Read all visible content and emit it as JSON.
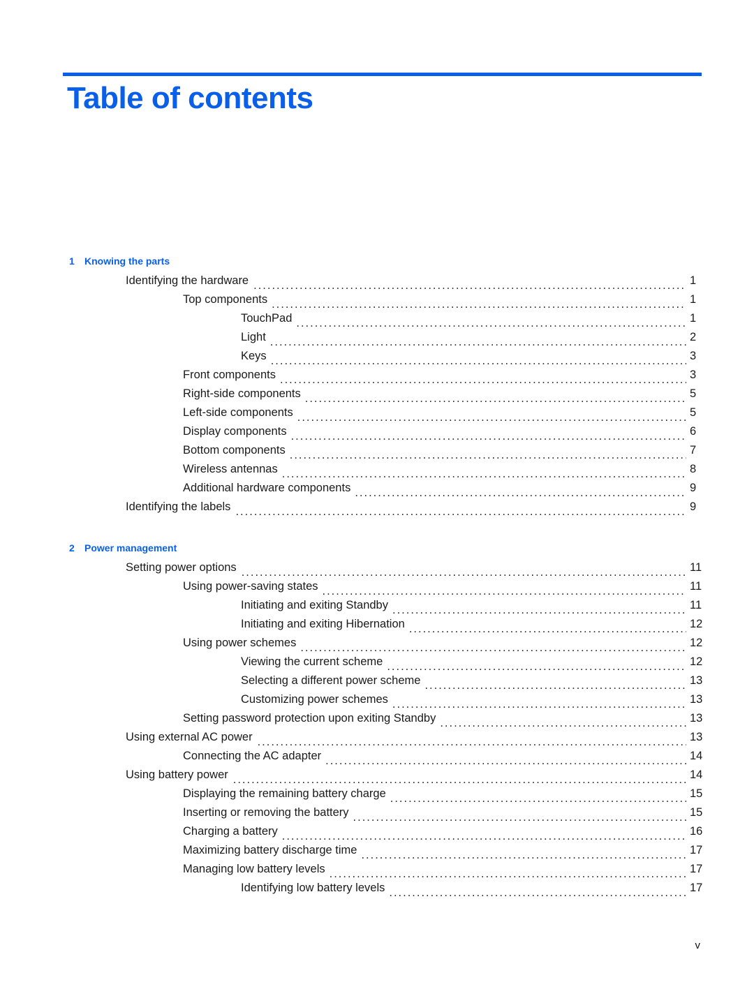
{
  "document": {
    "title": "Table of contents",
    "folio": "v"
  },
  "colors": {
    "accent_blue": "#0a5fe8",
    "body_text": "#1a1a1a"
  },
  "toc": {
    "chapters": [
      {
        "number": "1",
        "title": "Knowing the parts",
        "entries": [
          {
            "text": "Identifying the hardware",
            "page": "1",
            "level": 1
          },
          {
            "text": "Top components",
            "page": "1",
            "level": 2
          },
          {
            "text": "TouchPad",
            "page": "1",
            "level": 3
          },
          {
            "text": "Light",
            "page": "2",
            "level": 3
          },
          {
            "text": "Keys",
            "page": "3",
            "level": 3
          },
          {
            "text": "Front components",
            "page": "3",
            "level": 2
          },
          {
            "text": "Right-side components",
            "page": "5",
            "level": 2
          },
          {
            "text": "Left-side components",
            "page": "5",
            "level": 2
          },
          {
            "text": "Display components",
            "page": "6",
            "level": 2
          },
          {
            "text": "Bottom components",
            "page": "7",
            "level": 2
          },
          {
            "text": "Wireless antennas",
            "page": "8",
            "level": 2
          },
          {
            "text": "Additional hardware components",
            "page": "9",
            "level": 2
          },
          {
            "text": "Identifying the labels",
            "page": "9",
            "level": 1
          }
        ]
      },
      {
        "number": "2",
        "title": "Power management",
        "entries": [
          {
            "text": "Setting power options",
            "page": "11",
            "level": 1
          },
          {
            "text": "Using power-saving states",
            "page": "11",
            "level": 2
          },
          {
            "text": "Initiating and exiting Standby",
            "page": "11",
            "level": 3
          },
          {
            "text": "Initiating and exiting Hibernation",
            "page": "12",
            "level": 3
          },
          {
            "text": "Using power schemes",
            "page": "12",
            "level": 2
          },
          {
            "text": "Viewing the current scheme",
            "page": "12",
            "level": 3
          },
          {
            "text": "Selecting a different power scheme",
            "page": "13",
            "level": 3
          },
          {
            "text": "Customizing power schemes",
            "page": "13",
            "level": 3
          },
          {
            "text": "Setting password protection upon exiting Standby",
            "page": "13",
            "level": 2
          },
          {
            "text": "Using external AC power",
            "page": "13",
            "level": 1
          },
          {
            "text": "Connecting the AC adapter",
            "page": "14",
            "level": 2
          },
          {
            "text": "Using battery power",
            "page": "14",
            "level": 1
          },
          {
            "text": "Displaying the remaining battery charge",
            "page": "15",
            "level": 2
          },
          {
            "text": "Inserting or removing the battery",
            "page": "15",
            "level": 2
          },
          {
            "text": "Charging a battery",
            "page": "16",
            "level": 2
          },
          {
            "text": "Maximizing battery discharge time",
            "page": "17",
            "level": 2
          },
          {
            "text": "Managing low battery levels",
            "page": "17",
            "level": 2
          },
          {
            "text": "Identifying low battery levels",
            "page": "17",
            "level": 3
          }
        ]
      }
    ]
  }
}
